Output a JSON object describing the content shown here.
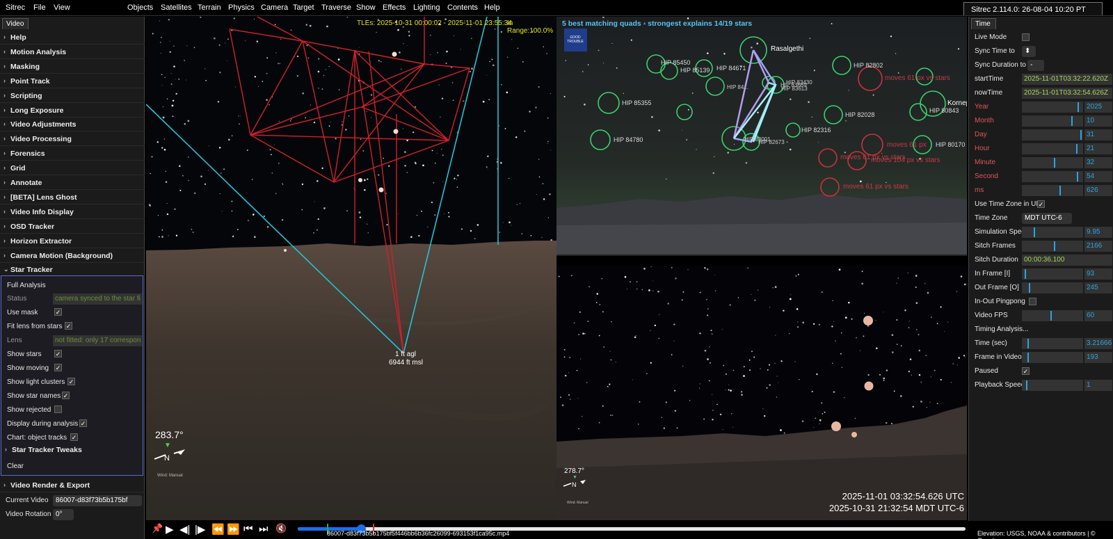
{
  "menubar": {
    "left": [
      "Sitrec",
      "File",
      "View"
    ],
    "main": [
      "Objects",
      "Satellites",
      "Terrain",
      "Physics",
      "Camera",
      "Target",
      "Traverse",
      "Show",
      "Effects",
      "Lighting",
      "Contents",
      "Help"
    ],
    "version": "Sitrec 2.114.0: 26-08-04 10:20 PT"
  },
  "left_panel": {
    "tab": "Video",
    "folders": [
      "Help",
      "Motion Analysis",
      "Masking",
      "Point Track",
      "Scripting",
      "Long Exposure",
      "Video Adjustments",
      "Video Processing",
      "Forensics",
      "Grid",
      "Annotate",
      "[BETA] Lens Ghost",
      "Video Info Display",
      "OSD Tracker",
      "Horizon Extractor",
      "Camera Motion (Background)"
    ],
    "star_tracker": {
      "title": "Star Tracker",
      "full_analysis": "Full Analysis",
      "status_label": "Status",
      "status_value": "camera synced to the star fi",
      "use_mask": "Use mask",
      "fit_lens": "Fit lens from stars",
      "lens_label": "Lens",
      "lens_value": "not fitted: only 17 correspon",
      "show_stars": "Show stars",
      "show_moving": "Show moving",
      "show_light_clusters": "Show light clusters",
      "show_star_names": "Show star names",
      "show_rejected": "Show rejected",
      "display_during": "Display during analysis",
      "chart_tracks": "Chart: object tracks",
      "tweaks": "Star Tracker Tweaks",
      "clear": "Clear"
    },
    "render_export": "Video Render & Export",
    "current_video_label": "Current Video",
    "current_video_value": "86007-d83f73b5b175bf",
    "video_rotation_label": "Video Rotation",
    "video_rotation_value": "0°"
  },
  "left_view": {
    "tle_text": "TLEs: 2025-10-31 00:00:02 - 2025-11-01 23:55:34",
    "in_range": "In Range:100.0%",
    "agl": "1 ft agl",
    "msl": "6944 ft msl",
    "heading": "283.7°",
    "compass": "N",
    "wind": "Wind: Manual"
  },
  "right_top": {
    "title": "5 best matching quads - strongest explains 14/19 stars",
    "logo": "GOOD TROUBLE",
    "stars": [
      "Rasalgethi",
      "HIP 85450",
      "HIP 85139",
      "HIP 84671",
      "HIP 82802",
      "HIP 85355",
      "HIP 82028",
      "HIP 80843",
      "Kornep",
      "HIP 84780",
      "HIP 82316",
      "HIP 80170",
      "HIP 83430",
      "HIP 83613",
      "HIP 83669",
      "HIP 82673",
      "HIP 84...",
      "HIP 83001"
    ],
    "moves": [
      "moves 61 px vs stars",
      "moves 61 px",
      "moves 61 px vs stars",
      "moves 104 px vs stars",
      "moves 61 px vs stars"
    ]
  },
  "right_bot": {
    "heading": "278.7°",
    "compass": "N",
    "wind": "Wind: Manual",
    "utc": "2025-11-01 03:32:54.626 UTC",
    "mdt": "2025-10-31 21:32:54 MDT UTC-6"
  },
  "time_panel": {
    "tab": "Time",
    "live_mode": "Live Mode",
    "sync_time": "Sync Time to",
    "sync_duration": "Sync Duration to",
    "sync_duration_value": "-",
    "start_time_label": "startTime",
    "start_time": "2025-11-01T03:32:22.620Z",
    "now_time_label": "nowTime",
    "now_time": "2025-11-01T03:32:54.626Z",
    "year": {
      "label": "Year",
      "value": "2025",
      "level": 0.93
    },
    "month": {
      "label": "Month",
      "value": "10",
      "level": 0.82
    },
    "day": {
      "label": "Day",
      "value": "31",
      "level": 0.98
    },
    "hour": {
      "label": "Hour",
      "value": "21",
      "level": 0.91
    },
    "minute": {
      "label": "Minute",
      "value": "32",
      "level": 0.54
    },
    "second": {
      "label": "Second",
      "value": "54",
      "level": 0.92
    },
    "ms": {
      "label": "ms",
      "value": "626",
      "level": 0.63
    },
    "use_tz": "Use Time Zone in UI",
    "tz_label": "Time Zone",
    "tz_value": "MDT UTC-6",
    "sim_speed": {
      "label": "Simulation Speed",
      "value": "9.95",
      "level": 0.2
    },
    "sitch_frames": {
      "label": "Sitch Frames",
      "value": "2166",
      "level": 0.54
    },
    "sitch_duration_label": "Sitch Duration",
    "sitch_duration": "00:00:36.100",
    "in_frame": {
      "label": "In Frame [I]",
      "value": "93",
      "level": 0.05
    },
    "out_frame": {
      "label": "Out Frame [O]",
      "value": "245",
      "level": 0.12
    },
    "pingpong": "In-Out Pingpong",
    "video_fps": {
      "label": "Video FPS",
      "value": "60",
      "level": 0.48
    },
    "timing": "Timing Analysis...",
    "time_sec": {
      "label": "Time (sec)",
      "value": "3.21666",
      "level": 0.09
    },
    "frame_video": {
      "label": "Frame in Video",
      "value": "193",
      "level": 0.09
    },
    "paused": "Paused",
    "playback": {
      "label": "Playback Speed",
      "value": "1",
      "level": 0.07
    }
  },
  "controls": {
    "progress": 0.095,
    "filename": "86007-d83f73b5b175bf5f446bb6b36fc26099-693153f1ca95c.mp4"
  },
  "attribution": "Elevation: USGS, NOAA & contributors | © Google",
  "colors": {
    "accent": "#2aa5e0",
    "green": "#a6d65a",
    "red_label": "#e05656",
    "cyan_line": "#21c3d6",
    "frustum": "#d0202a"
  }
}
